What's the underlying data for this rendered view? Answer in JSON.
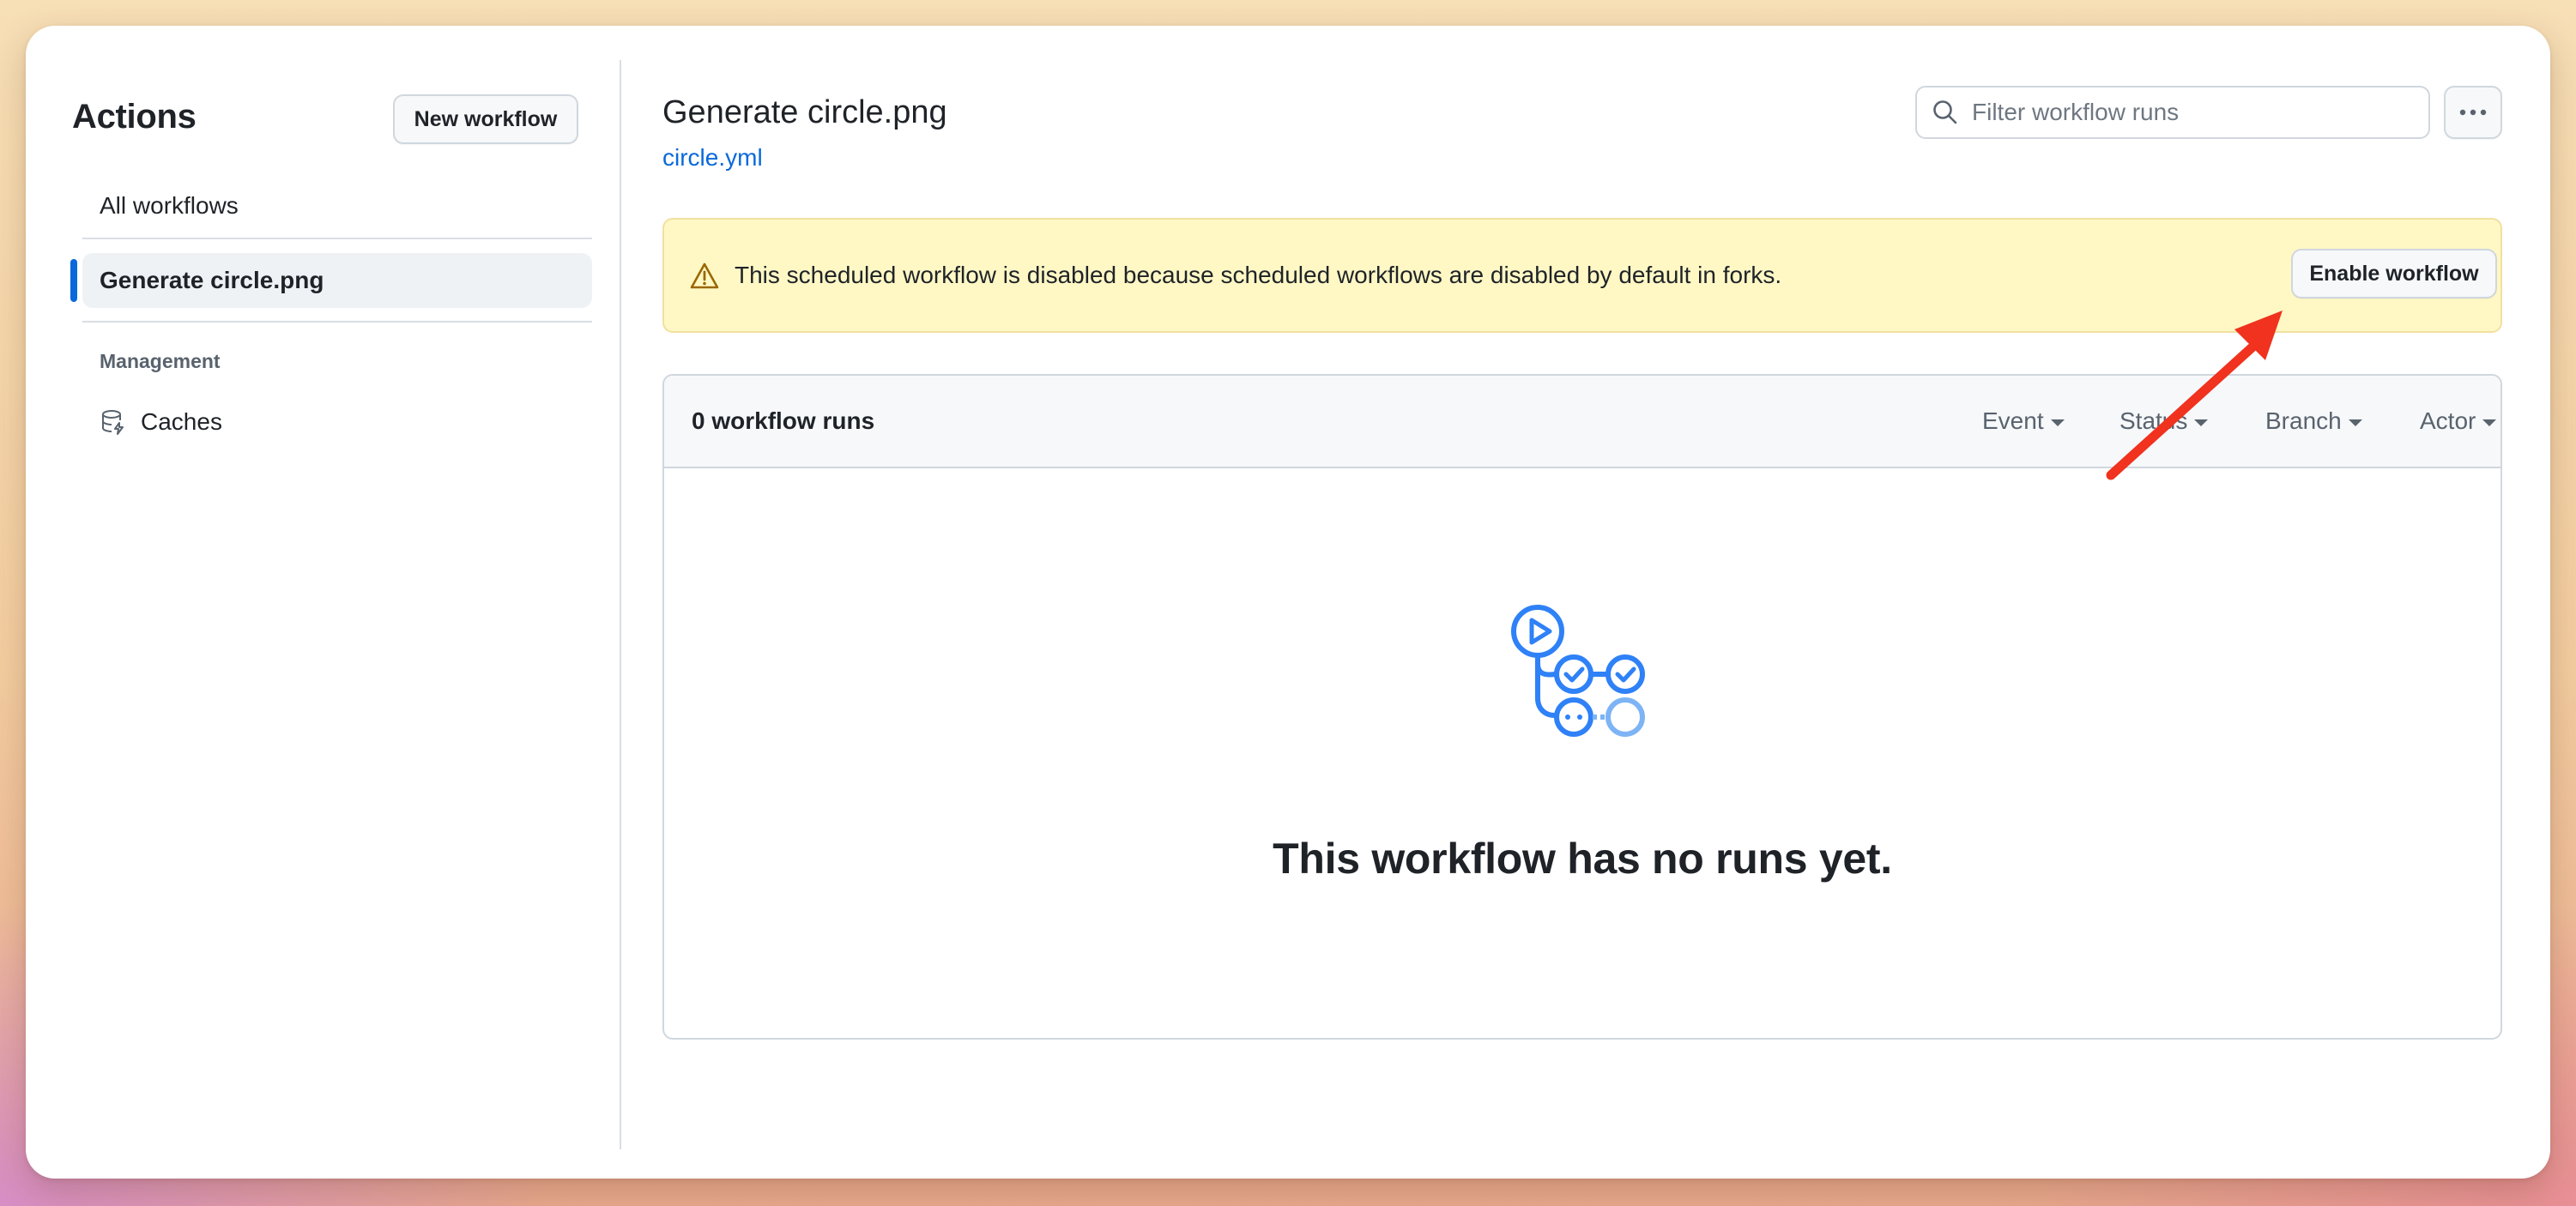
{
  "sidebar": {
    "title": "Actions",
    "new_workflow_label": "New workflow",
    "all_workflows_label": "All workflows",
    "active_workflow_label": "Generate circle.png",
    "section_label": "Management",
    "caches_label": "Caches",
    "caches_icon": "database-icon"
  },
  "header": {
    "title": "Generate circle.png",
    "file_link": "circle.yml",
    "search_placeholder": "Filter workflow runs",
    "search_value": "",
    "more_label": "···"
  },
  "banner": {
    "icon": "alert-triangle-icon",
    "message": "This scheduled workflow is disabled because scheduled workflows are disabled by default in forks.",
    "enable_label": "Enable workflow"
  },
  "runs": {
    "count_label": "0 workflow runs",
    "filters": {
      "event": "Event",
      "status": "Status",
      "branch": "Branch",
      "actor": "Actor"
    },
    "empty_message": "This workflow has no runs yet."
  },
  "colors": {
    "accent": "#0969da",
    "banner_bg": "#fff8c5",
    "annotation_arrow": "#f0321e",
    "illustration_blue": "#2f81f7"
  }
}
